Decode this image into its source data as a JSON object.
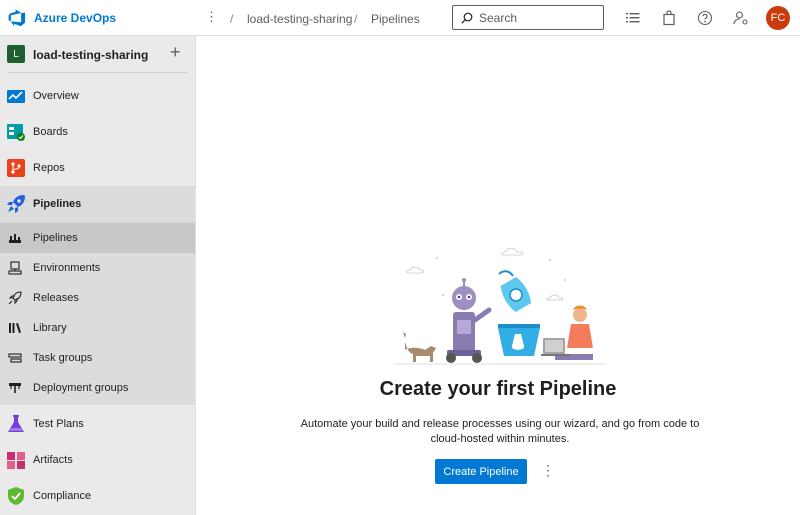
{
  "header": {
    "brand": "Azure DevOps",
    "more_icon": "vertical-ellipsis",
    "breadcrumb": [
      "load-testing-sharing",
      "Pipelines"
    ],
    "search_placeholder": "Search",
    "avatar_initials": "FC",
    "avatar_color": "#ca3a0a",
    "accent": "#0078d4"
  },
  "sidebar": {
    "project_badge": "L",
    "project_name": "load-testing-sharing",
    "add_icon": "+",
    "items": [
      {
        "label": "Overview"
      },
      {
        "label": "Boards"
      },
      {
        "label": "Repos"
      },
      {
        "label": "Pipelines"
      },
      {
        "label": "Test Plans"
      },
      {
        "label": "Artifacts"
      },
      {
        "label": "Compliance"
      }
    ],
    "pipeline_subitems": [
      {
        "label": "Pipelines"
      },
      {
        "label": "Environments"
      },
      {
        "label": "Releases"
      },
      {
        "label": "Library"
      },
      {
        "label": "Task groups"
      },
      {
        "label": "Deployment groups"
      }
    ]
  },
  "main": {
    "title": "Create your first Pipeline",
    "description": "Automate your build and release processes using our wizard, and go from code to cloud-hosted within minutes.",
    "create_button": "Create Pipeline",
    "more_icon": "⋮"
  }
}
